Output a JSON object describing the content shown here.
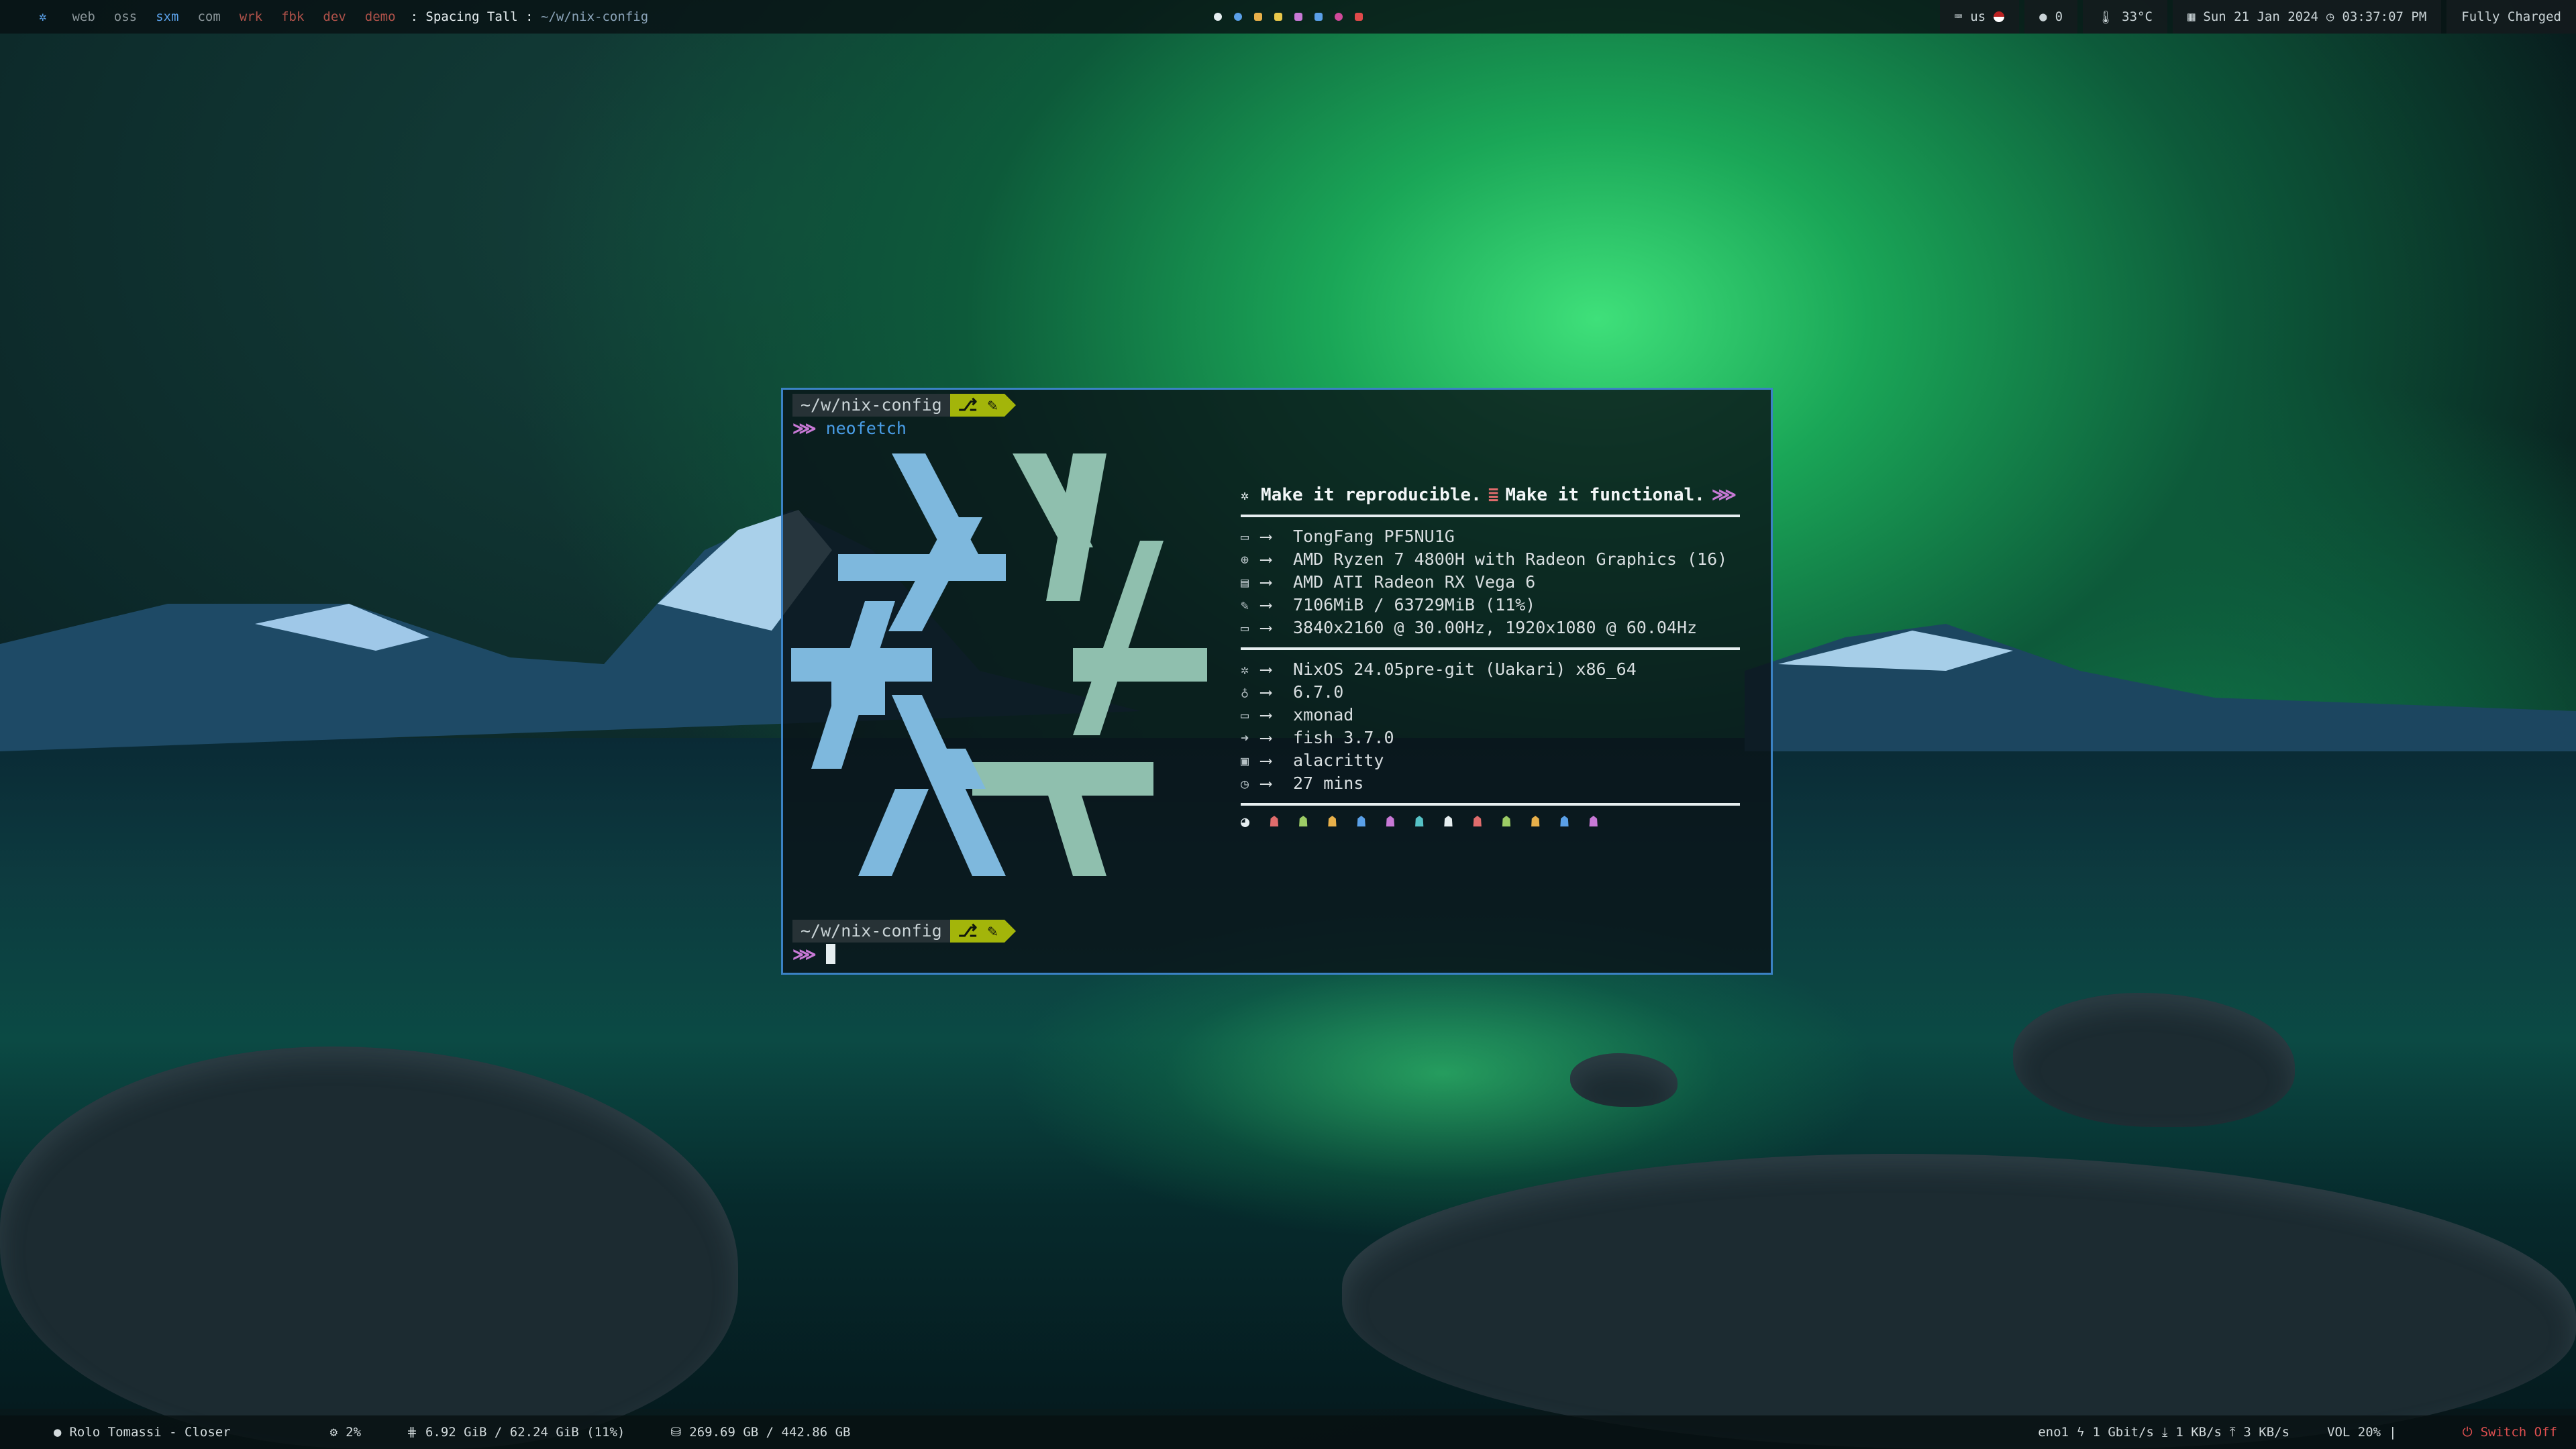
{
  "topbar": {
    "workspaces": [
      {
        "label": "web",
        "color": "#8a9599"
      },
      {
        "label": "oss",
        "color": "#8a9599"
      },
      {
        "label": "sxm",
        "color": "#5aa0e8"
      },
      {
        "label": "com",
        "color": "#8a9599"
      },
      {
        "label": "wrk",
        "color": "#b0524a"
      },
      {
        "label": "fbk",
        "color": "#b0524a"
      },
      {
        "label": "dev",
        "color": "#b0524a"
      },
      {
        "label": "demo",
        "color": "#b0524a"
      }
    ],
    "layout": ": Spacing Tall : ",
    "window_title": "~/w/nix-config",
    "keyboard": "us",
    "github_count": "0",
    "temperature": "33°C",
    "date": "Sun 21 Jan 2024",
    "time": "03:37:07 PM",
    "battery": "Fully Charged"
  },
  "terminal": {
    "prompt_path": "~/w/nix-config",
    "prompt_git": "",
    "command": "neofetch",
    "headline_a": "Make it reproducible.",
    "headline_b": "Make it functional.",
    "hardware": [
      {
        "icon": "laptop-icon",
        "glyph": "▭",
        "value": "TongFang PF5NU1G"
      },
      {
        "icon": "cpu-icon",
        "glyph": "⊕",
        "value": "AMD Ryzen 7 4800H with Radeon Graphics (16)"
      },
      {
        "icon": "gpu-icon",
        "glyph": "▤",
        "value": "AMD ATI Radeon RX Vega 6"
      },
      {
        "icon": "memory-icon",
        "glyph": "✎",
        "value": "7106MiB / 63729MiB (11%)"
      },
      {
        "icon": "display-icon",
        "glyph": "▭",
        "value": "3840x2160 @ 30.00Hz, 1920x1080 @ 60.04Hz"
      }
    ],
    "software": [
      {
        "icon": "os-icon",
        "glyph": "✲",
        "value": "NixOS 24.05pre-git (Uakari) x86_64"
      },
      {
        "icon": "kernel-icon",
        "glyph": "♁",
        "value": "6.7.0"
      },
      {
        "icon": "wm-icon",
        "glyph": "▭",
        "value": "xmonad"
      },
      {
        "icon": "shell-icon",
        "glyph": "➜",
        "value": "fish 3.7.0"
      },
      {
        "icon": "terminal-icon",
        "glyph": "▣",
        "value": "alacritty"
      },
      {
        "icon": "uptime-icon",
        "glyph": "◷",
        "value": "27 mins"
      }
    ],
    "arrow": "⟶",
    "palette": [
      "#e6eef0",
      "#e06c6c",
      "#9ccc65",
      "#e8b04a",
      "#5aa0e8",
      "#c879d6",
      "#56c2c6",
      "#e6eef0",
      "#e06c6c",
      "#9ccc65",
      "#e8b04a",
      "#5aa0e8",
      "#c879d6"
    ]
  },
  "bottombar": {
    "music": "Rolo Tomassi - Closer",
    "cpu": "2%",
    "memory": "6.92 GiB / 62.24 GiB (11%)",
    "disk": "269.69 GB / 442.86 GB",
    "net_iface": "eno1",
    "net_speed": "1 Gbit/s",
    "down": "1 KB/s",
    "up": "3 KB/s",
    "volume": "VOL 20%",
    "power": "Switch Off"
  }
}
